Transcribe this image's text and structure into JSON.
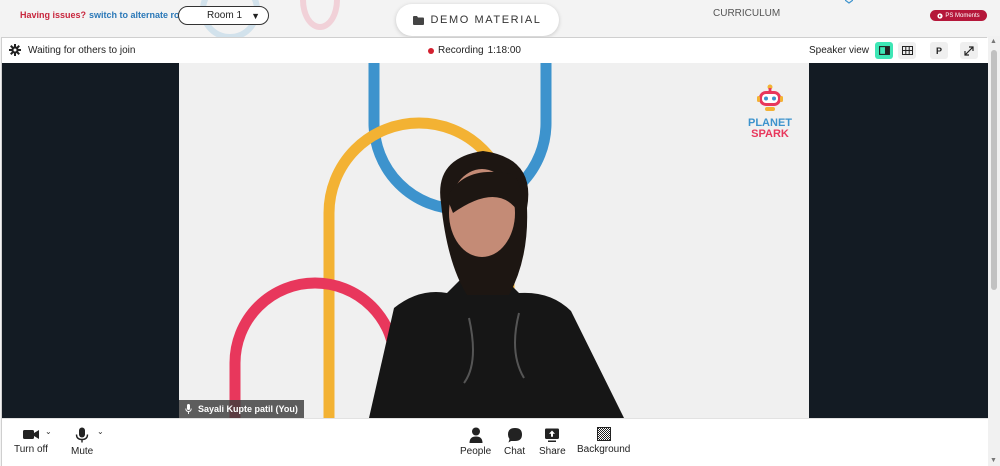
{
  "topbar": {
    "issue_text": "Having issues?",
    "switch_link": "switch to alternate room",
    "room_label": "Room 1",
    "demo_label": "DEMO MATERIAL",
    "curriculum_label": "CURRICULUM",
    "ps_moments_label": "PS Moments",
    "colors": {
      "issue_red": "#c8263d",
      "link_blue": "#2a78b8",
      "ps_badge": "#b5173a"
    }
  },
  "callbar": {
    "waiting_text": "Waiting for others to join",
    "recording_label": "Recording",
    "recording_time": "1:18:00",
    "speaker_view_label": "Speaker view",
    "p_button_label": "P",
    "colors": {
      "active_view": "#3ee6b5",
      "rec_dot": "#d3202f"
    }
  },
  "video": {
    "participant_name": "Sayali Kupte patil (You)",
    "brand_line1": "PLANET",
    "brand_line2": "SPARK",
    "colors": {
      "stage_bg": "#131b23",
      "arc_blue": "#3d93cd",
      "arc_yellow": "#f3b233",
      "arc_red": "#e8375c"
    }
  },
  "controls": {
    "turn_off_label": "Turn off",
    "mute_label": "Mute",
    "people_label": "People",
    "chat_label": "Chat",
    "share_label": "Share",
    "background_label": "Background"
  }
}
